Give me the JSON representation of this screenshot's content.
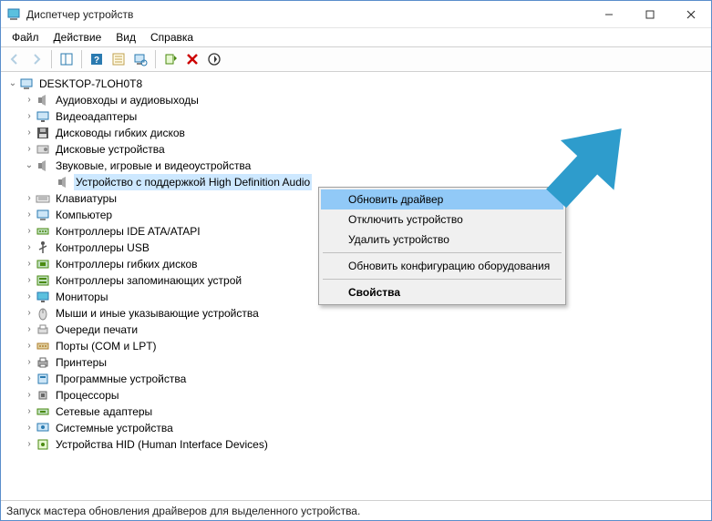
{
  "window": {
    "title": "Диспетчер устройств"
  },
  "menubar": {
    "file": "Файл",
    "action": "Действие",
    "view": "Вид",
    "help": "Справка"
  },
  "tree": {
    "root": "DESKTOP-7LOH0T8",
    "items": [
      {
        "label": "Аудиовходы и аудиовыходы",
        "icon": "speaker"
      },
      {
        "label": "Видеоадаптеры",
        "icon": "monitor"
      },
      {
        "label": "Дисководы гибких дисков",
        "icon": "floppy"
      },
      {
        "label": "Дисковые устройства",
        "icon": "disk"
      },
      {
        "label": "Звуковые, игровые и видеоустройства",
        "icon": "speaker",
        "expanded": true,
        "children": [
          {
            "label": "Устройство с поддержкой High Definition Audio",
            "icon": "speaker",
            "selected": true
          }
        ]
      },
      {
        "label": "Клавиатуры",
        "icon": "keyboard"
      },
      {
        "label": "Компьютер",
        "icon": "computer"
      },
      {
        "label": "Контроллеры IDE ATA/ATAPI",
        "icon": "ide"
      },
      {
        "label": "Контроллеры USB",
        "icon": "usb"
      },
      {
        "label": "Контроллеры гибких дисков",
        "icon": "floppyctl"
      },
      {
        "label": "Контроллеры запоминающих устрой",
        "icon": "storage"
      },
      {
        "label": "Мониторы",
        "icon": "display"
      },
      {
        "label": "Мыши и иные указывающие устройства",
        "icon": "mouse"
      },
      {
        "label": "Очереди печати",
        "icon": "printqueue"
      },
      {
        "label": "Порты (COM и LPT)",
        "icon": "port"
      },
      {
        "label": "Принтеры",
        "icon": "printer"
      },
      {
        "label": "Программные устройства",
        "icon": "software"
      },
      {
        "label": "Процессоры",
        "icon": "cpu"
      },
      {
        "label": "Сетевые адаптеры",
        "icon": "network"
      },
      {
        "label": "Системные устройства",
        "icon": "system"
      },
      {
        "label": "Устройства HID (Human Interface Devices)",
        "icon": "hid"
      }
    ]
  },
  "context_menu": {
    "items": [
      {
        "label": "Обновить драйвер",
        "hovered": true
      },
      {
        "label": "Отключить устройство"
      },
      {
        "label": "Удалить устройство"
      },
      {
        "sep": true
      },
      {
        "label": "Обновить конфигурацию оборудования"
      },
      {
        "sep": true
      },
      {
        "label": "Свойства",
        "bold": true
      }
    ]
  },
  "statusbar": {
    "text": "Запуск мастера обновления драйверов для выделенного устройства."
  },
  "arrow": {
    "color": "#2e9ccc"
  }
}
